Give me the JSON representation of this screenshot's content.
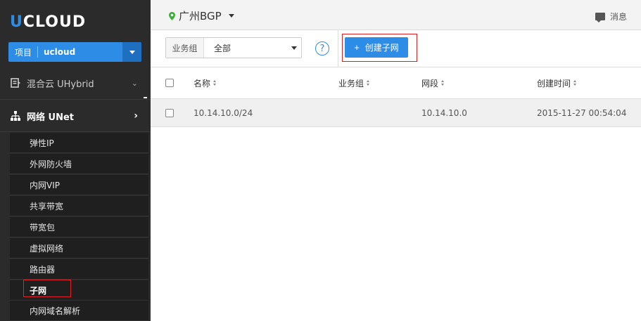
{
  "brand": {
    "logo_u": "U",
    "logo_rest": "CLOUD",
    "accent": "#2d8ce6"
  },
  "project": {
    "label": "项目",
    "value": "ucloud"
  },
  "sidebar": {
    "groups": [
      {
        "label": "混合云 UHybrid",
        "icon": "hybrid-icon",
        "arrow": "⌄"
      },
      {
        "label": "网络 UNet",
        "icon": "network-icon",
        "arrow": "›"
      }
    ],
    "items": [
      {
        "label": "弹性IP"
      },
      {
        "label": "外网防火墙"
      },
      {
        "label": "内网VIP"
      },
      {
        "label": "共享带宽"
      },
      {
        "label": "带宽包"
      },
      {
        "label": "虚拟网络"
      },
      {
        "label": "路由器"
      },
      {
        "label": "子网",
        "active": true
      },
      {
        "label": "内网域名解析"
      }
    ]
  },
  "topbar": {
    "region": "广州BGP",
    "messages_label": "消息"
  },
  "toolbar": {
    "group_label": "业务组",
    "group_value": "全部",
    "help": "?",
    "create_plus": "+",
    "create_label": "创建子网"
  },
  "table": {
    "columns": [
      "名称",
      "业务组",
      "网段",
      "创建时间"
    ],
    "rows": [
      {
        "name": "10.14.10.0/24",
        "group": "",
        "segment": "10.14.10.0",
        "created": "2015-11-27 00:54:04"
      }
    ]
  }
}
